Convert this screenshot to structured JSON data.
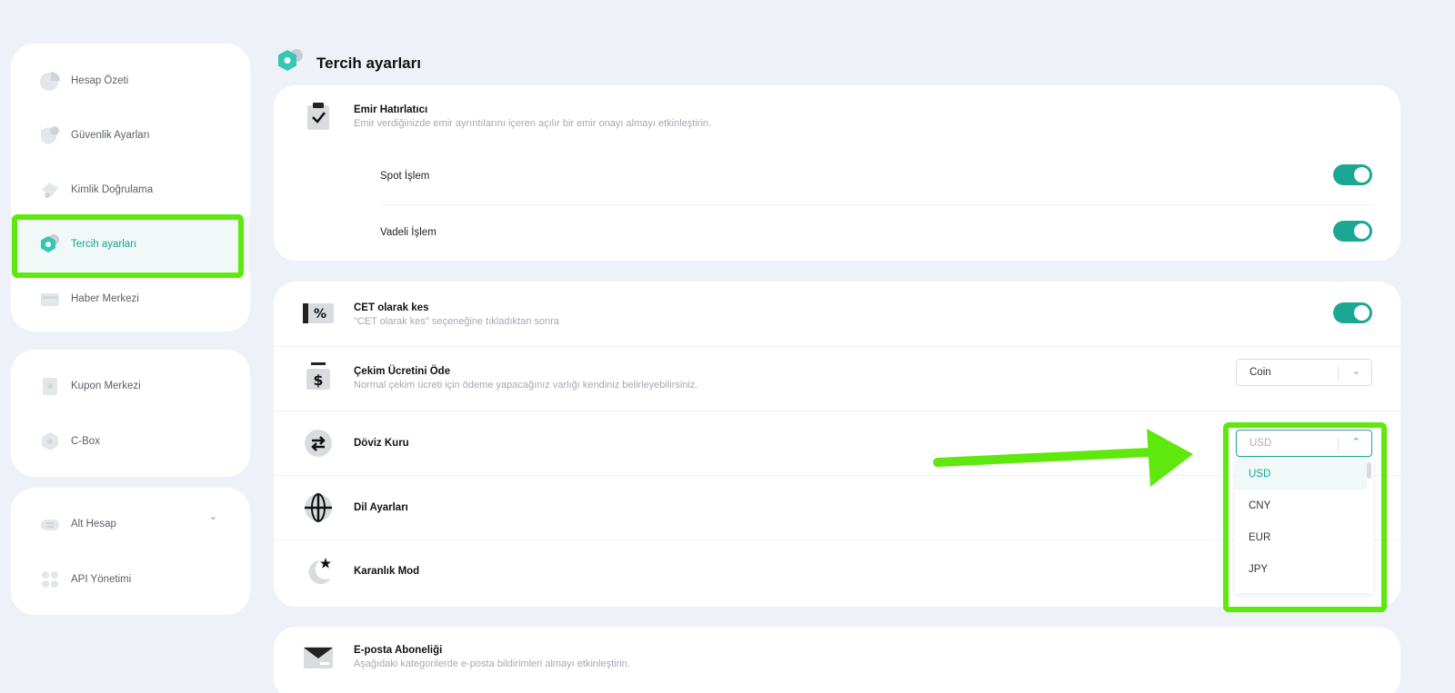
{
  "sidebar": {
    "group1": [
      {
        "label": "Hesap Özeti",
        "icon": "pie-chart-icon"
      },
      {
        "label": "Güvenlik Ayarları",
        "icon": "shield-icon"
      },
      {
        "label": "Kimlik Doğrulama",
        "icon": "id-badge-icon"
      },
      {
        "label": "Tercih ayarları",
        "icon": "preferences-icon",
        "active": true
      },
      {
        "label": "Haber Merkezi",
        "icon": "news-icon"
      }
    ],
    "group2": [
      {
        "label": "Kupon Merkezi",
        "icon": "coupon-icon"
      },
      {
        "label": "C-Box",
        "icon": "box-icon"
      }
    ],
    "group3": [
      {
        "label": "Alt Hesap",
        "icon": "sub-account-icon",
        "expandable": true
      },
      {
        "label": "API Yönetimi",
        "icon": "api-icon"
      }
    ]
  },
  "page": {
    "title": "Tercih ayarları"
  },
  "reminder_card": {
    "title": "Emir Hatırlatıcı",
    "desc": "Emir verdiğinizde emir ayrıntılarını içeren açılır bir emir onayı almayı etkinleştirin.",
    "options": [
      {
        "label": "Spot İşlem",
        "enabled": true
      },
      {
        "label": "Vadeli İşlem",
        "enabled": true
      }
    ]
  },
  "settings_card": {
    "cet": {
      "title": "CET olarak kes",
      "desc": "\"CET olarak kes\" seçeneğine tıkladıktan sonra",
      "enabled": true
    },
    "fee": {
      "title": "Çekim Ücretini Öde",
      "desc": "Normal çekim ücreti için ödeme yapacağınız varlığı kendiniz belirleyebilirsiniz.",
      "selected": "Coin"
    },
    "currency": {
      "title": "Döviz Kuru",
      "selected": "USD",
      "options": [
        "USD",
        "CNY",
        "EUR",
        "JPY"
      ]
    },
    "language": {
      "title": "Dil Ayarları"
    },
    "dark": {
      "title": "Karanlık Mod"
    }
  },
  "email_card": {
    "title": "E-posta Aboneliği",
    "desc": "Aşağıdaki kategorilerde e-posta bildirimleri almayı etkinleştirin."
  },
  "colors": {
    "accent": "#1aa895",
    "highlight": "#5ee80e",
    "background": "#eef1f8"
  }
}
